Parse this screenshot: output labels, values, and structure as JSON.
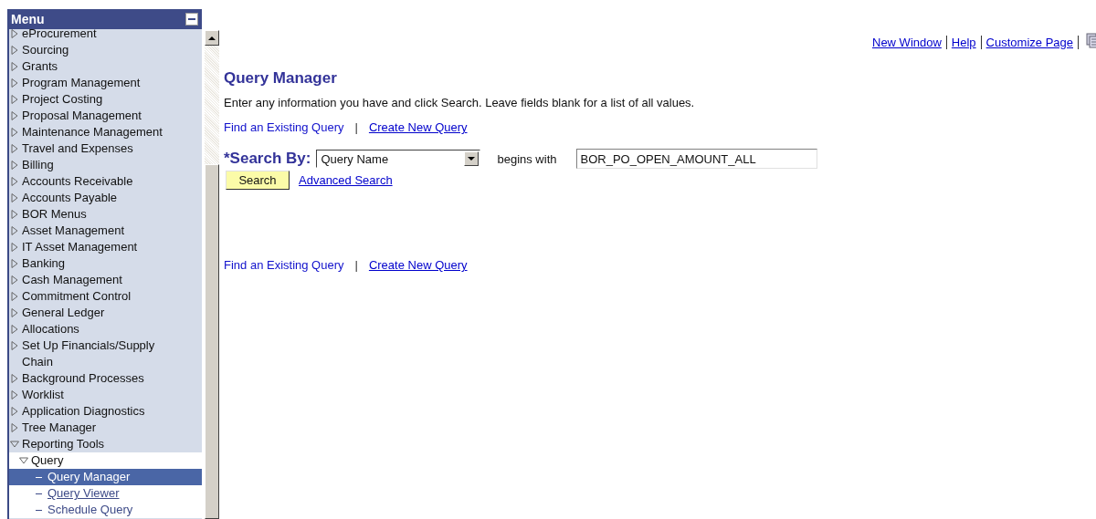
{
  "menu": {
    "title": "Menu",
    "items": [
      {
        "label": "eProcurement",
        "expanded": false
      },
      {
        "label": "Sourcing",
        "expanded": false
      },
      {
        "label": "Grants",
        "expanded": false
      },
      {
        "label": "Program Management",
        "expanded": false
      },
      {
        "label": "Project Costing",
        "expanded": false
      },
      {
        "label": "Proposal Management",
        "expanded": false
      },
      {
        "label": "Maintenance Management",
        "expanded": false
      },
      {
        "label": "Travel and Expenses",
        "expanded": false
      },
      {
        "label": "Billing",
        "expanded": false
      },
      {
        "label": "Accounts Receivable",
        "expanded": false
      },
      {
        "label": "Accounts Payable",
        "expanded": false
      },
      {
        "label": "BOR Menus",
        "expanded": false
      },
      {
        "label": "Asset Management",
        "expanded": false
      },
      {
        "label": "IT Asset Management",
        "expanded": false
      },
      {
        "label": "Banking",
        "expanded": false
      },
      {
        "label": "Cash Management",
        "expanded": false
      },
      {
        "label": "Commitment Control",
        "expanded": false
      },
      {
        "label": "General Ledger",
        "expanded": false
      },
      {
        "label": "Allocations",
        "expanded": false
      },
      {
        "label": "Set Up Financials/Supply Chain",
        "expanded": false
      },
      {
        "label": "Background Processes",
        "expanded": false
      },
      {
        "label": "Worklist",
        "expanded": false
      },
      {
        "label": "Application Diagnostics",
        "expanded": false
      },
      {
        "label": "Tree Manager",
        "expanded": false
      },
      {
        "label": "Reporting Tools",
        "expanded": true,
        "children": [
          {
            "label": "Query",
            "expanded": true,
            "children": [
              {
                "label": "Query Manager",
                "selected": true,
                "underlined": false
              },
              {
                "label": "Query Viewer",
                "selected": false,
                "underlined": true
              },
              {
                "label": "Schedule Query",
                "selected": false,
                "underlined": false
              }
            ]
          }
        ]
      }
    ]
  },
  "header_links": [
    "New Window",
    "Help",
    "Customize Page"
  ],
  "page": {
    "title": "Query Manager",
    "instructions": "Enter any information you have and click Search. Leave fields blank for a list of all values.",
    "top_links": {
      "find": "Find an Existing Query",
      "separator": "|",
      "create": "Create New Query"
    },
    "search_by": {
      "label": "*Search By:",
      "value": "Query Name",
      "operator": "begins with",
      "input": "BOR_PO_OPEN_AMOUNT_ALL"
    },
    "search_button": "Search",
    "advanced_link": "Advanced Search",
    "bottom_links": {
      "find": "Find an Existing Query",
      "separator": "|",
      "create": "Create New Query"
    }
  }
}
